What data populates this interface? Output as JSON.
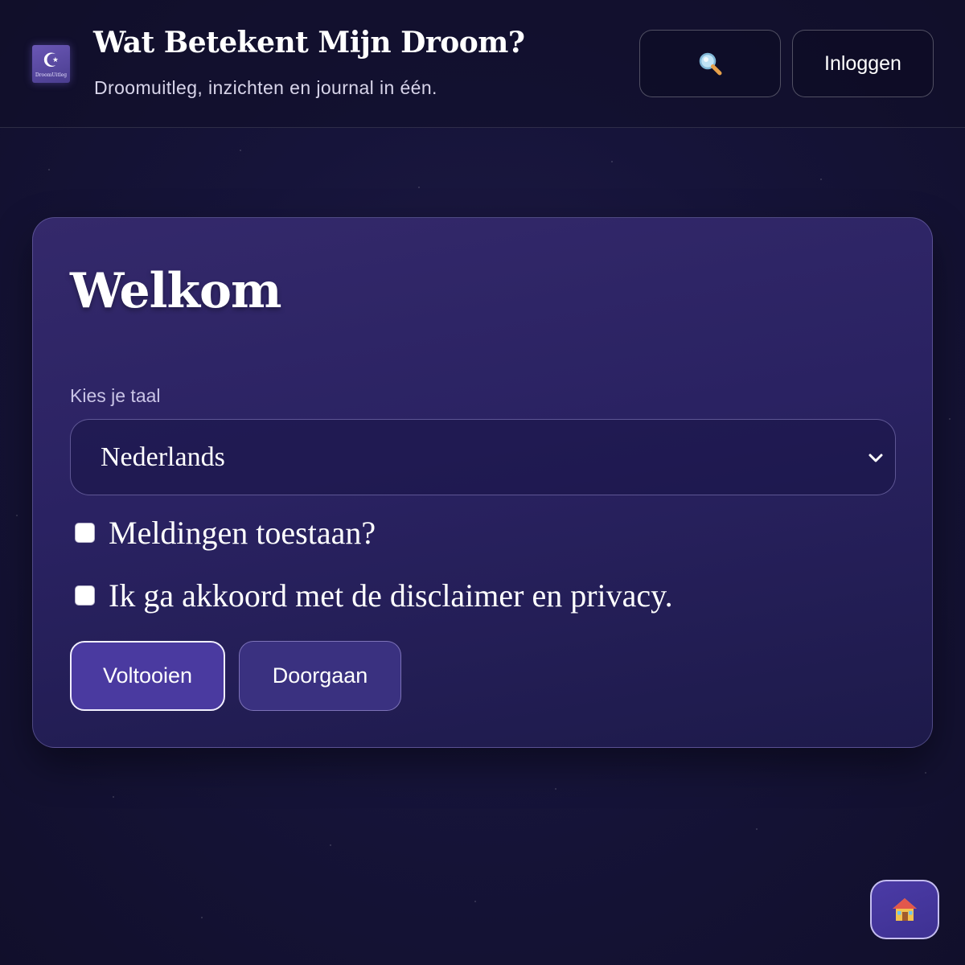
{
  "header": {
    "logo_text": "DroomUitleg",
    "title": "Wat Betekent Mijn Droom?",
    "tagline": "Droomuitleg, inzichten en journal in één.",
    "search_icon": "search-icon",
    "login_label": "Inloggen"
  },
  "card": {
    "title": "Welkom",
    "language_label": "Kies je taal",
    "language_selected": "Nederlands",
    "checkboxes": [
      {
        "label": "Meldingen toestaan?",
        "checked": false
      },
      {
        "label": "Ik ga akkoord met de disclaimer en privacy.",
        "checked": false
      }
    ],
    "primary_button": "Voltooien",
    "secondary_button": "Doorgaan"
  },
  "floating": {
    "home_icon": "house-icon"
  },
  "colors": {
    "background": "#16143a",
    "card": "#2a2262",
    "primary_button": "#4a3aa0",
    "accent": "#6a57b5"
  }
}
